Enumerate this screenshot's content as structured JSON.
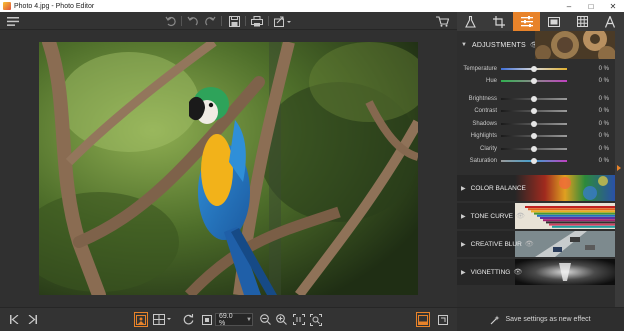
{
  "window": {
    "title": "Photo 4.jpg - Photo Editor"
  },
  "toolbar": {
    "icons": [
      "menu-icon",
      "undo-icon",
      "redo-icon",
      "save-icon",
      "print-icon",
      "share-icon",
      "cart-icon"
    ]
  },
  "tabs": [
    {
      "name": "edit-tools",
      "active": false
    },
    {
      "name": "crop",
      "active": false
    },
    {
      "name": "adjustments",
      "active": true
    },
    {
      "name": "frames",
      "active": false
    },
    {
      "name": "textures",
      "active": false
    },
    {
      "name": "text",
      "active": false
    }
  ],
  "adjustments": {
    "title": "ADJUSTMENTS",
    "sliders": [
      {
        "label": "Temperature",
        "value": "0 %",
        "gradient": "temp"
      },
      {
        "label": "Hue",
        "value": "0 %",
        "gradient": "hue"
      },
      {
        "label": "Brightness",
        "value": "0 %",
        "gradient": "gray"
      },
      {
        "label": "Contrast",
        "value": "0 %",
        "gradient": "gray"
      },
      {
        "label": "Shadows",
        "value": "0 %",
        "gradient": "gray"
      },
      {
        "label": "Highlights",
        "value": "0 %",
        "gradient": "gray"
      },
      {
        "label": "Clarity",
        "value": "0 %",
        "gradient": "gray"
      },
      {
        "label": "Saturation",
        "value": "0 %",
        "gradient": "sat"
      }
    ]
  },
  "sections": [
    {
      "label": "COLOR BALANCE"
    },
    {
      "label": "TONE CURVE"
    },
    {
      "label": "CREATIVE BLUR"
    },
    {
      "label": "VIGNETTING"
    }
  ],
  "bottom": {
    "zoom": "69.0 %",
    "save_effect": "Save settings as new effect"
  },
  "colors": {
    "accent": "#e8832a",
    "panel_bg": "#2e2e2e",
    "toolbar_bg": "#333333"
  }
}
